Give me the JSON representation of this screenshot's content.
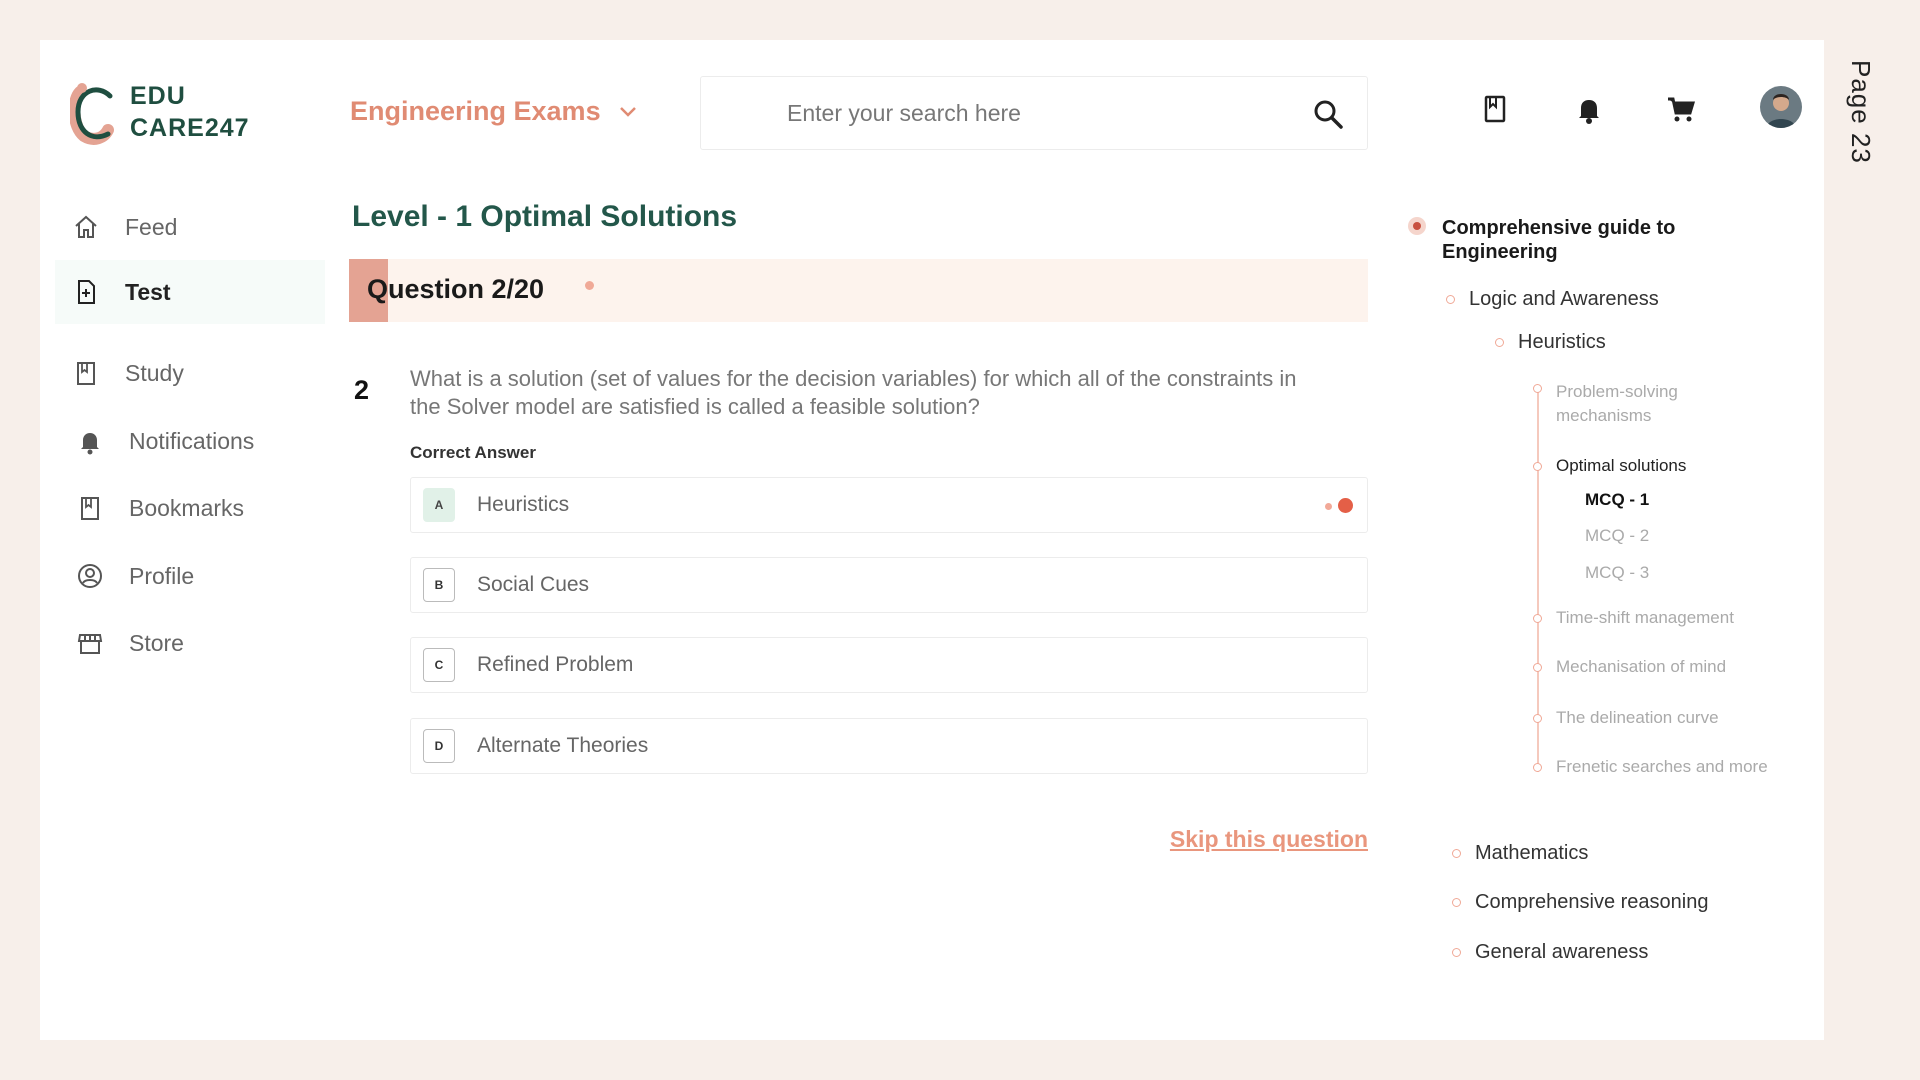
{
  "page": {
    "label": "Page 23"
  },
  "brand": {
    "line1": "EDU",
    "line2": "CARE247"
  },
  "header": {
    "exam_select": "Engineering Exams",
    "search_placeholder": "Enter your search here"
  },
  "sidebar": {
    "items": [
      {
        "label": "Feed",
        "icon": "home-icon"
      },
      {
        "label": "Test",
        "icon": "test-doc-icon",
        "active": true
      },
      {
        "label": "Study",
        "icon": "study-book-icon"
      },
      {
        "label": "Notifications",
        "icon": "bell-icon"
      },
      {
        "label": "Bookmarks",
        "icon": "bookmark-icon"
      },
      {
        "label": "Profile",
        "icon": "profile-icon"
      },
      {
        "label": "Store",
        "icon": "store-icon"
      }
    ]
  },
  "main": {
    "level_title": "Level - 1 Optimal Solutions",
    "question_progress": "Question 2/20",
    "question_number": "2",
    "question_text": "What is a solution (set of values for the decision variables) for which all of the constraints in the Solver model are satisfied is called a feasible solution?",
    "correct_answer_label": "Correct Answer",
    "options": [
      {
        "key": "A",
        "text": "Heuristics",
        "selected": true
      },
      {
        "key": "B",
        "text": "Social Cues"
      },
      {
        "key": "C",
        "text": "Refined Problem"
      },
      {
        "key": "D",
        "text": "Alternate Theories"
      }
    ],
    "skip_label": "Skip this question"
  },
  "tree": {
    "root": "Comprehensive guide to Engineering",
    "section": "Logic and Awareness",
    "topic": "Heuristics",
    "subtopics": [
      "Problem-solving mechanisms",
      "Optimal solutions",
      "Time-shift management",
      "Mechanisation of mind",
      "The delineation curve",
      "Frenetic searches and more"
    ],
    "mcqs": [
      "MCQ - 1",
      "MCQ - 2",
      "MCQ - 3"
    ],
    "other_sections": [
      "Mathematics",
      "Comprehensive reasoning",
      "General awareness"
    ]
  },
  "colors": {
    "brand_green": "#1f4e40",
    "accent_salmon": "#e08b73",
    "selected_dot": "#e45f47"
  }
}
